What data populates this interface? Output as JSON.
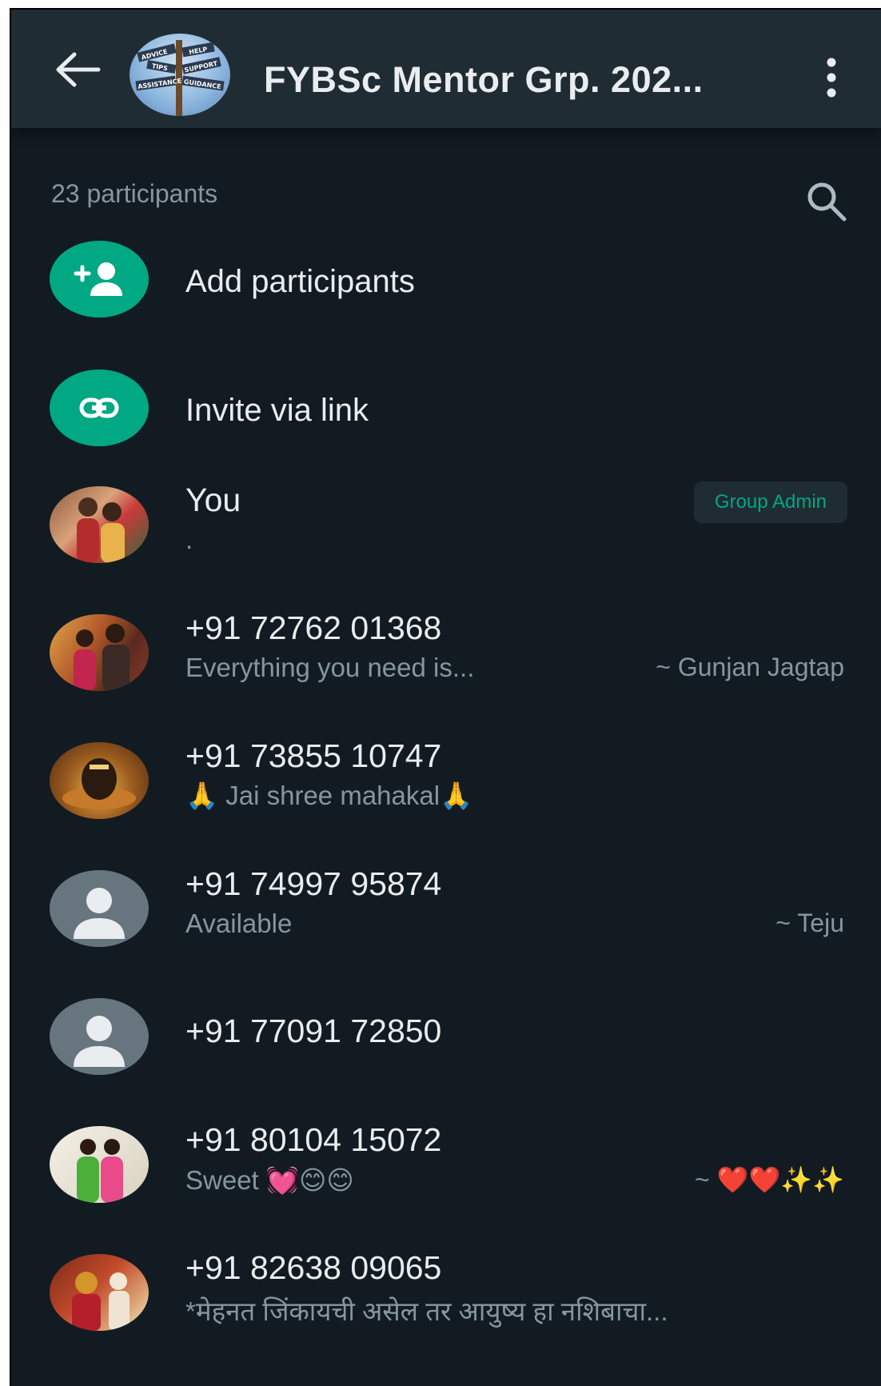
{
  "header": {
    "title": "FYBSc Mentor Grp. 202...",
    "group_avatar_labels": [
      "ADVICE",
      "HELP",
      "TIPS",
      "SUPPORT",
      "ASSISTANCE",
      "GUIDANCE"
    ]
  },
  "participants": {
    "count_label": "23 participants"
  },
  "actions": [
    {
      "label": "Add participants",
      "icon": "add-person-icon"
    },
    {
      "label": "Invite via link",
      "icon": "link-icon"
    }
  ],
  "members": [
    {
      "name": "You",
      "status": ".",
      "alias": "",
      "badge": "Group Admin"
    },
    {
      "name": "+91 72762 01368",
      "status": "Everything you need is...",
      "alias": "~ Gunjan Jagtap",
      "badge": ""
    },
    {
      "name": "+91 73855 10747",
      "status": "🙏 Jai shree mahakal🙏",
      "alias": "",
      "badge": ""
    },
    {
      "name": "+91 74997 95874",
      "status": "Available",
      "alias": "~ Teju",
      "badge": ""
    },
    {
      "name": "+91 77091 72850",
      "status": "",
      "alias": "",
      "badge": ""
    },
    {
      "name": "+91 80104 15072",
      "status": "Sweet 💓😊😊",
      "alias": "~ ❤️❤️✨✨",
      "badge": ""
    },
    {
      "name": "+91 82638 09065",
      "status": "*मेहनत जिंकायची असेल तर आयुष्य हा नशिबाचा...",
      "alias": "",
      "badge": ""
    }
  ],
  "colors": {
    "background": "#121b22",
    "header": "#202c33",
    "accent": "#00a884",
    "primary_text": "#e9edef",
    "secondary_text": "#8696a0"
  }
}
